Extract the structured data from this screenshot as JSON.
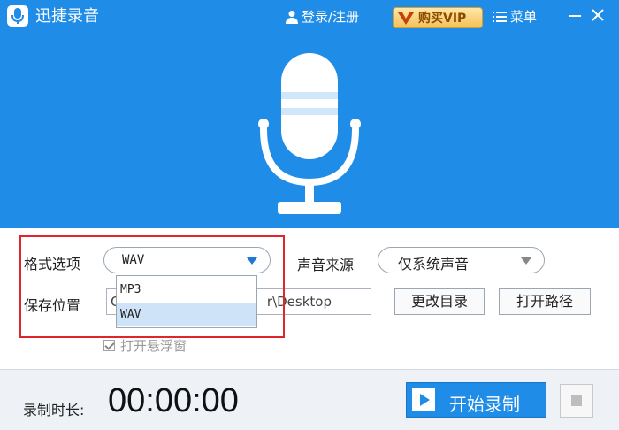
{
  "header": {
    "app_title": "迅捷录音",
    "login_label": "登录/注册",
    "vip_label": "购买VIP",
    "menu_label": "菜单",
    "brand_color": "#1f8ce8",
    "icons": [
      "microphone-logo-icon",
      "user-icon",
      "vip-badge-icon",
      "hamburger-menu-icon",
      "minimize-icon",
      "close-icon",
      "microphone-icon"
    ]
  },
  "settings": {
    "format_label": "格式选项",
    "format_value": "WAV",
    "format_options": [
      "MP3",
      "WAV"
    ],
    "source_label": "声音来源",
    "source_value": "仅系统声音",
    "save_label": "保存位置",
    "save_path_prefix": "C",
    "save_path_suffix": "r\\Desktop",
    "change_dir_label": "更改目录",
    "open_path_label": "打开路径",
    "floating_window_label": "打开悬浮窗",
    "floating_window_checked": true
  },
  "footer": {
    "duration_label": "录制时长:",
    "timer": "00:00:00",
    "start_label": "开始录制"
  }
}
